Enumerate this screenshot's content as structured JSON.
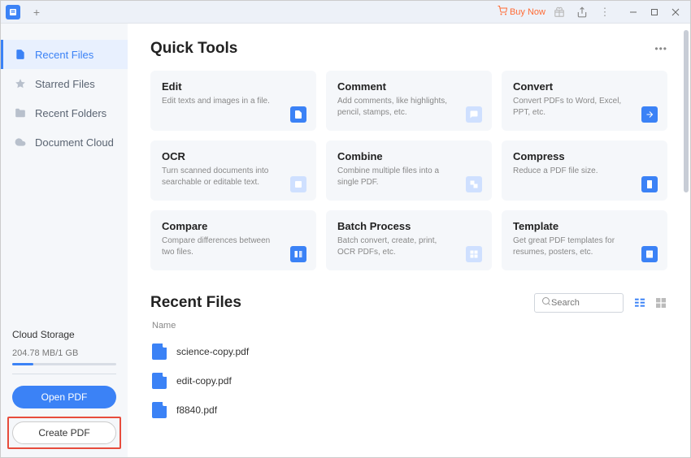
{
  "titlebar": {
    "buy_now": "Buy Now"
  },
  "sidebar": {
    "items": [
      {
        "label": "Recent Files"
      },
      {
        "label": "Starred Files"
      },
      {
        "label": "Recent Folders"
      },
      {
        "label": "Document Cloud"
      }
    ],
    "storage": {
      "title": "Cloud Storage",
      "usage": "204.78 MB/1 GB"
    },
    "open_btn": "Open PDF",
    "create_btn": "Create PDF"
  },
  "quick_tools": {
    "title": "Quick Tools",
    "cards": [
      {
        "title": "Edit",
        "desc": "Edit texts and images in a file."
      },
      {
        "title": "Comment",
        "desc": "Add comments, like highlights, pencil, stamps, etc."
      },
      {
        "title": "Convert",
        "desc": "Convert PDFs to Word, Excel, PPT, etc."
      },
      {
        "title": "OCR",
        "desc": "Turn scanned documents into searchable or editable text."
      },
      {
        "title": "Combine",
        "desc": "Combine multiple files into a single PDF."
      },
      {
        "title": "Compress",
        "desc": "Reduce a PDF file size."
      },
      {
        "title": "Compare",
        "desc": "Compare differences between two files."
      },
      {
        "title": "Batch Process",
        "desc": "Batch convert, create, print, OCR PDFs, etc."
      },
      {
        "title": "Template",
        "desc": "Get great PDF templates for resumes, posters, etc."
      }
    ]
  },
  "recent": {
    "title": "Recent Files",
    "search_placeholder": "Search",
    "col_name": "Name",
    "files": [
      {
        "name": "science-copy.pdf"
      },
      {
        "name": "edit-copy.pdf"
      },
      {
        "name": "f8840.pdf"
      }
    ]
  }
}
